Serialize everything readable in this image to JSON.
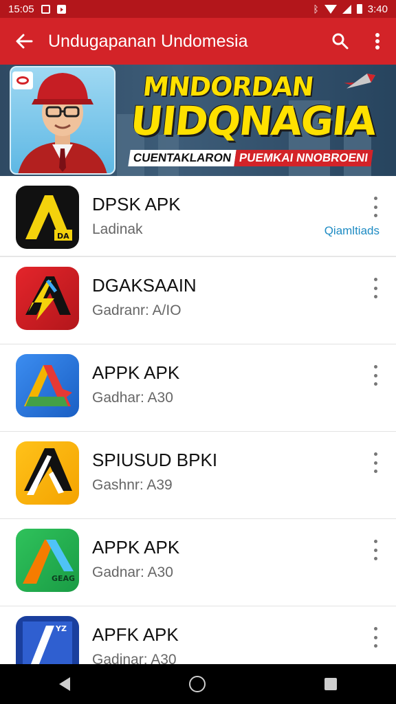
{
  "status_bar": {
    "time": "15:05",
    "clock_right": "3:40"
  },
  "app_bar": {
    "title": "Undugapanan Undomesia"
  },
  "banner": {
    "headline_line1": "MNDORDAN",
    "headline_line2": "UIDQNAGIA",
    "tag_left": "CUENTAKLARON",
    "tag_right": "PUEMKAI NNOBROENI"
  },
  "apps": [
    {
      "name": "DPSK APK",
      "subtitle": "Ladinak",
      "link": "Qiamltiads",
      "icon": "apk-yellow-a-icon"
    },
    {
      "name": "DGAKSAAIN",
      "subtitle": "Gadranr: A/IO",
      "icon": "apk-red-lightning-icon"
    },
    {
      "name": "APPK APK",
      "subtitle": "Gadhar: A30",
      "icon": "apk-blue-a-icon"
    },
    {
      "name": "SPIUSUD BPKI",
      "subtitle": "Gashnr: A39",
      "icon": "apk-orange-a-icon"
    },
    {
      "name": "APPK APK",
      "subtitle": "Gadnar: A30",
      "icon": "apk-green-a-icon",
      "icon_label": "GEAG"
    },
    {
      "name": "APFK APK",
      "subtitle": "Gadinar: A30",
      "icon": "apk-navy-a-icon",
      "icon_label": "YZ"
    }
  ],
  "colors": {
    "primary": "#d32328",
    "status": "#b3161b",
    "accent_yellow": "#ffe100",
    "link": "#1e8bc3"
  }
}
